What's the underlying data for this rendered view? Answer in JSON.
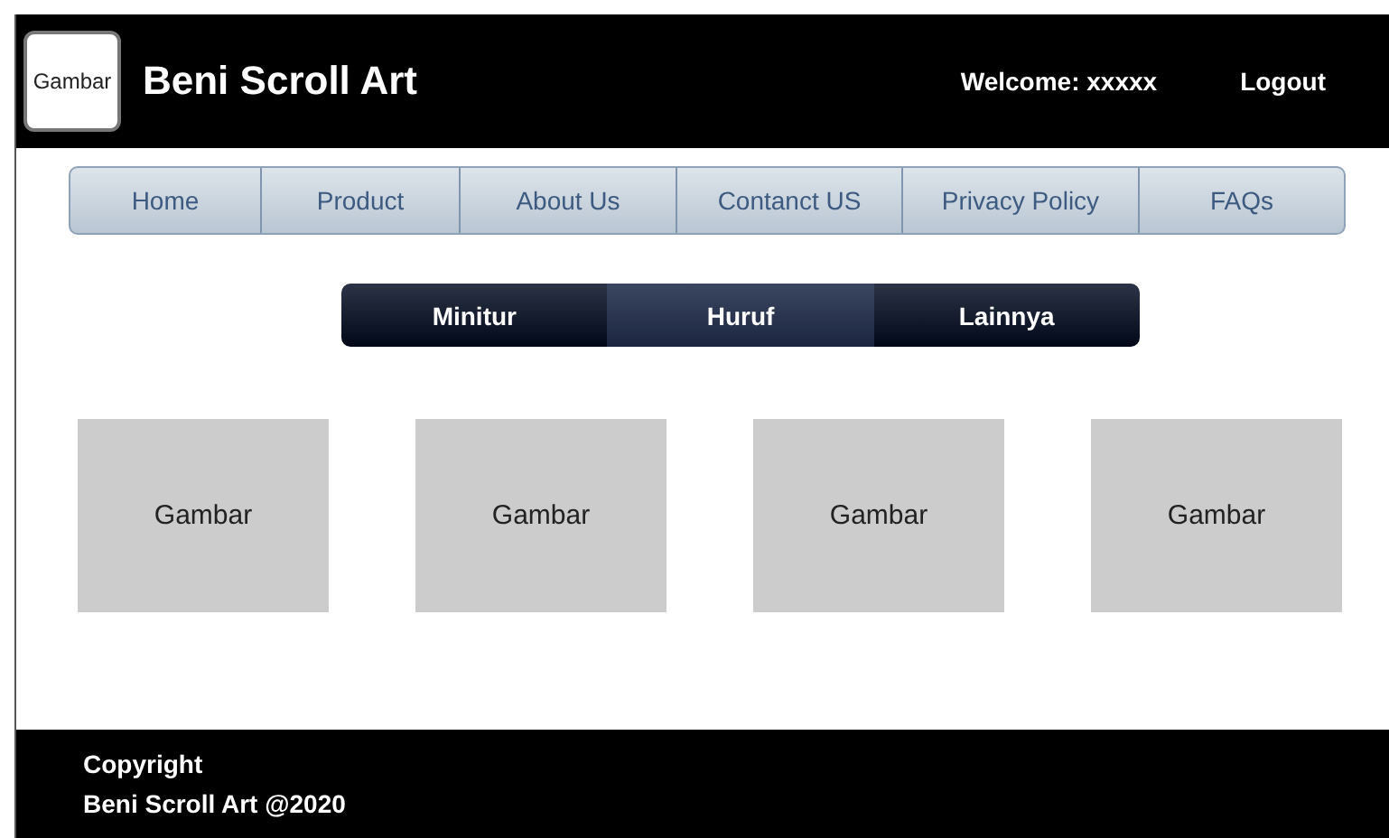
{
  "header": {
    "logo": "Gambar",
    "title": "Beni Scroll Art",
    "welcome": "Welcome: xxxxx",
    "logout": "Logout"
  },
  "nav": [
    "Home",
    "Product",
    "About Us",
    "Contanct US",
    "Privacy Policy",
    "FAQs"
  ],
  "tabs": [
    {
      "label": "Minitur",
      "selected": false
    },
    {
      "label": "Huruf",
      "selected": true
    },
    {
      "label": "Lainnya",
      "selected": false
    }
  ],
  "tiles": [
    "Gambar",
    "Gambar",
    "Gambar",
    "Gambar"
  ],
  "footer": {
    "lines": [
      "Copyright",
      "Beni Scroll Art @2020"
    ]
  }
}
